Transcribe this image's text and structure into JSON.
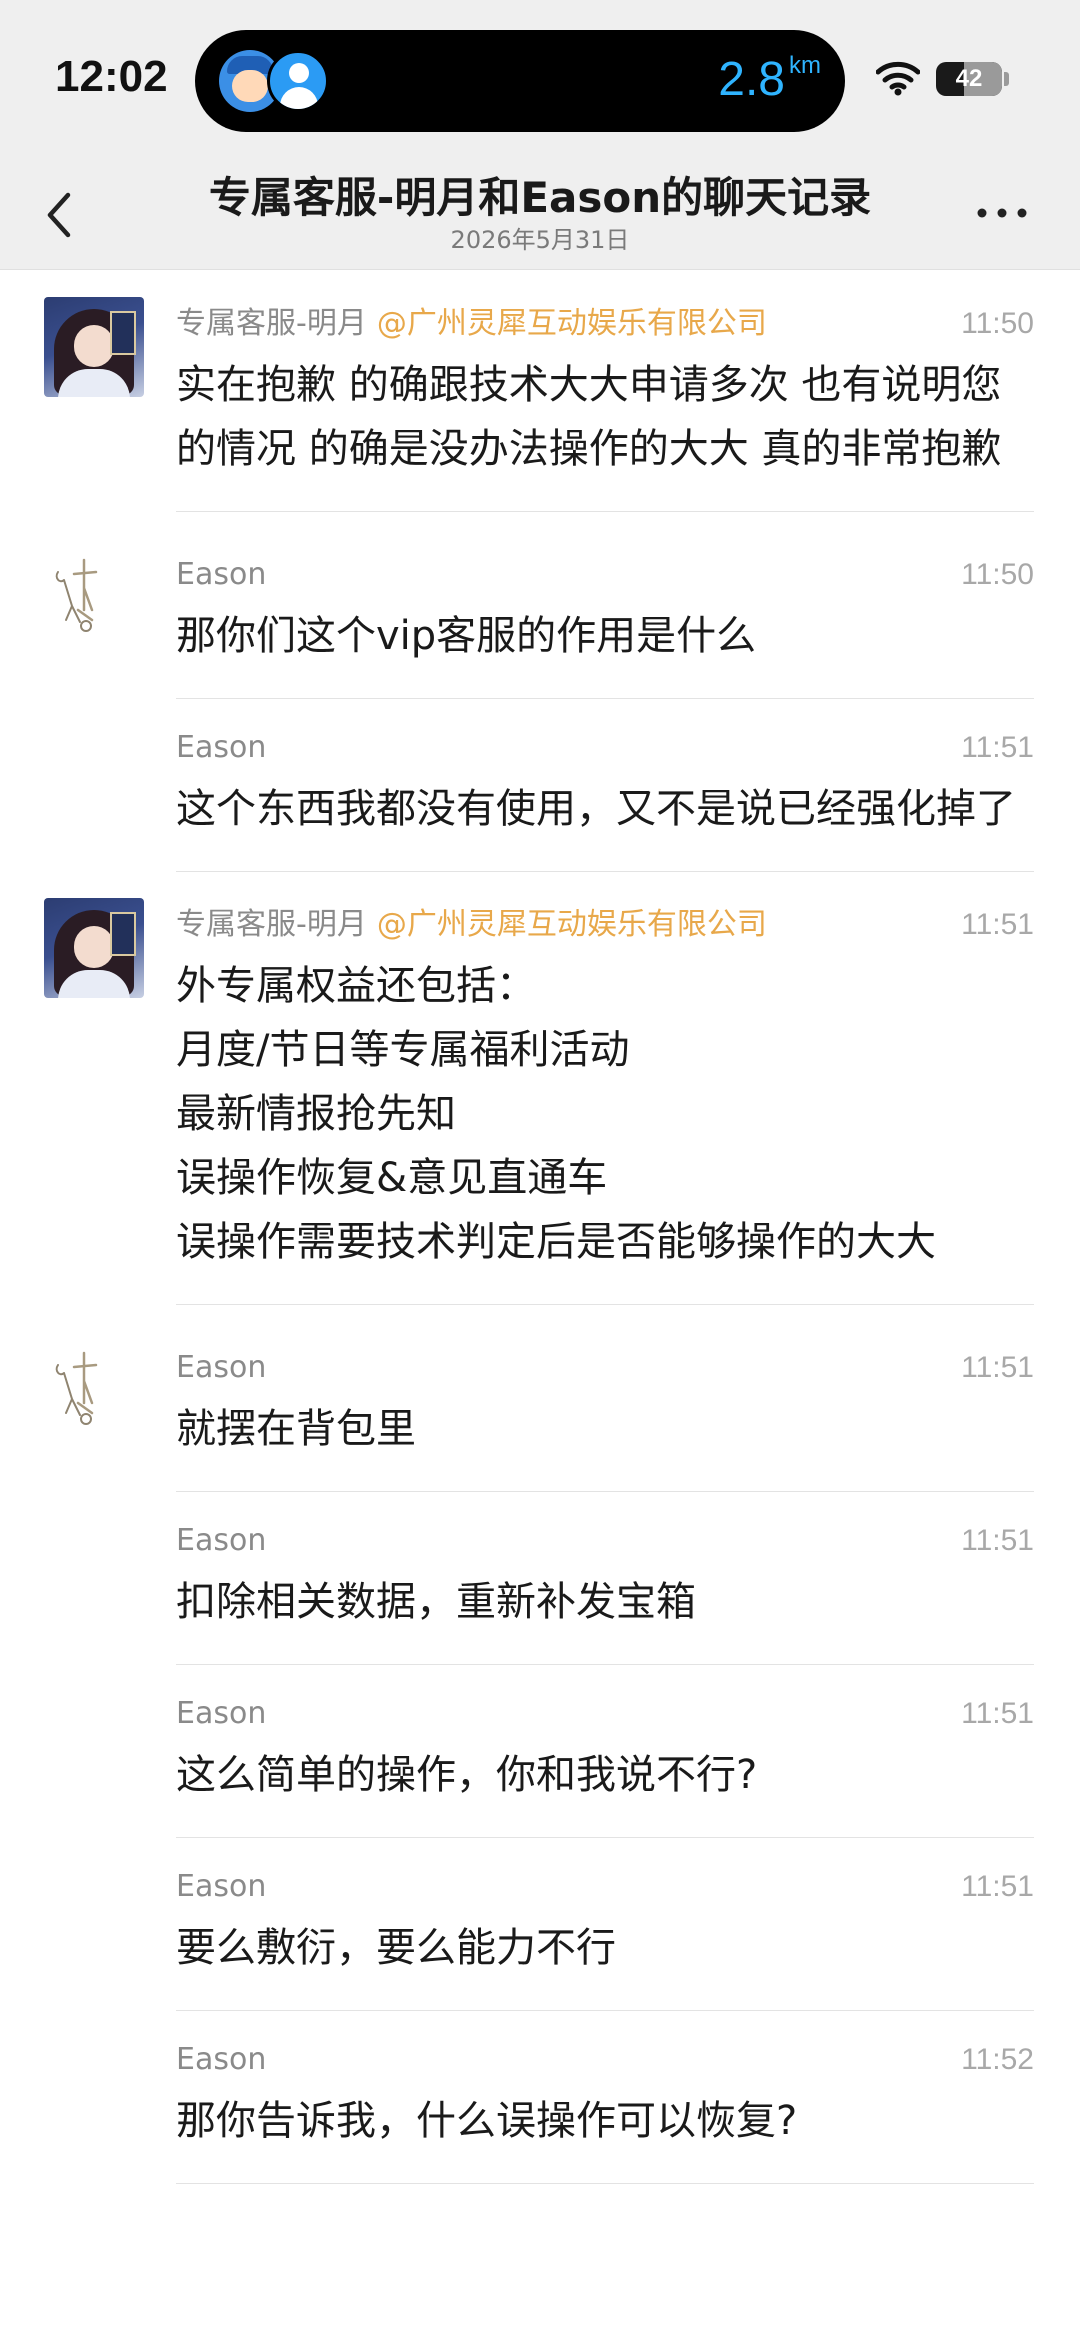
{
  "status_bar": {
    "time": "12:02",
    "distance_value": "2.8",
    "distance_unit": "km",
    "battery": "42",
    "battery_level": 0.42
  },
  "nav": {
    "title": "专属客服-明月和Eason的聊天记录",
    "subtitle": "2026年5月31日"
  },
  "messages": [
    {
      "sender": "专属客服-明月",
      "org": "@广州灵犀互动娱乐有限公司",
      "time": "11:50",
      "text": "实在抱歉 的确跟技术大大申请多次  也有说明您的情况  的确是没办法操作的大大  真的非常抱歉",
      "avatar": "cs"
    },
    {
      "sender": "Eason",
      "org": "",
      "time": "11:50",
      "text": "那你们这个vip客服的作用是什么",
      "avatar": "user"
    },
    {
      "sender": "Eason",
      "org": "",
      "time": "11:51",
      "text": "这个东西我都没有使用，又不是说已经强化掉了",
      "avatar": "none"
    },
    {
      "sender": "专属客服-明月",
      "org": "@广州灵犀互动娱乐有限公司",
      "time": "11:51",
      "text": "外专属权益还包括：\n月度/节日等专属福利活动\n最新情报抢先知\n误操作恢复&意见直通车\n误操作需要技术判定后是否能够操作的大大",
      "avatar": "cs"
    },
    {
      "sender": "Eason",
      "org": "",
      "time": "11:51",
      "text": "就摆在背包里",
      "avatar": "user"
    },
    {
      "sender": "Eason",
      "org": "",
      "time": "11:51",
      "text": "扣除相关数据，重新补发宝箱",
      "avatar": "none"
    },
    {
      "sender": "Eason",
      "org": "",
      "time": "11:51",
      "text": "这么简单的操作，你和我说不行?",
      "avatar": "none"
    },
    {
      "sender": "Eason",
      "org": "",
      "time": "11:51",
      "text": "要么敷衍，要么能力不行",
      "avatar": "none"
    },
    {
      "sender": "Eason",
      "org": "",
      "time": "11:52",
      "text": "那你告诉我，什么误操作可以恢复?",
      "avatar": "none"
    }
  ]
}
